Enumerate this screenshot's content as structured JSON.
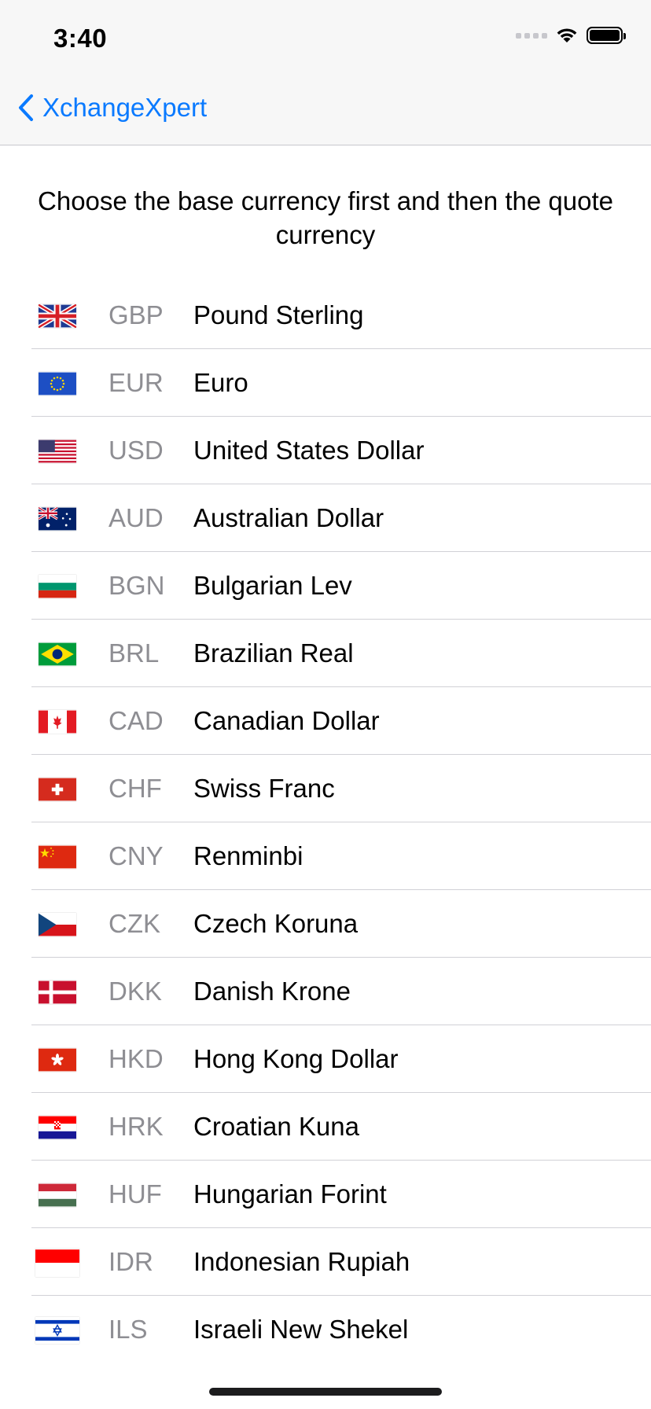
{
  "status_bar": {
    "time": "3:40"
  },
  "nav": {
    "back_label": "XchangeXpert"
  },
  "instruction": "Choose the base currency first and then the quote currency",
  "currencies": [
    {
      "code": "GBP",
      "name": "Pound Sterling",
      "flag": "uk-flag"
    },
    {
      "code": "EUR",
      "name": "Euro",
      "flag": "eu-flag"
    },
    {
      "code": "USD",
      "name": "United States Dollar",
      "flag": "us-flag"
    },
    {
      "code": "AUD",
      "name": "Australian Dollar",
      "flag": "australia-flag"
    },
    {
      "code": "BGN",
      "name": "Bulgarian Lev",
      "flag": "bulgaria-flag"
    },
    {
      "code": "BRL",
      "name": "Brazilian Real",
      "flag": "brazil-flag"
    },
    {
      "code": "CAD",
      "name": "Canadian Dollar",
      "flag": "canada-flag"
    },
    {
      "code": "CHF",
      "name": "Swiss Franc",
      "flag": "switzerland-flag"
    },
    {
      "code": "CNY",
      "name": "Renminbi",
      "flag": "china-flag"
    },
    {
      "code": "CZK",
      "name": "Czech Koruna",
      "flag": "czech-flag"
    },
    {
      "code": "DKK",
      "name": "Danish Krone",
      "flag": "denmark-flag"
    },
    {
      "code": "HKD",
      "name": "Hong Kong Dollar",
      "flag": "hong-kong-flag"
    },
    {
      "code": "HRK",
      "name": "Croatian Kuna",
      "flag": "croatia-flag"
    },
    {
      "code": "HUF",
      "name": "Hungarian Forint",
      "flag": "hungary-flag"
    },
    {
      "code": "IDR",
      "name": "Indonesian Rupiah",
      "flag": "indonesia-flag"
    },
    {
      "code": "ILS",
      "name": "Israeli New Shekel",
      "flag": "israel-flag"
    }
  ],
  "colors": {
    "accent": "#0a7aff",
    "code_gray": "#8e8e93",
    "separator": "#d1d1d6"
  }
}
